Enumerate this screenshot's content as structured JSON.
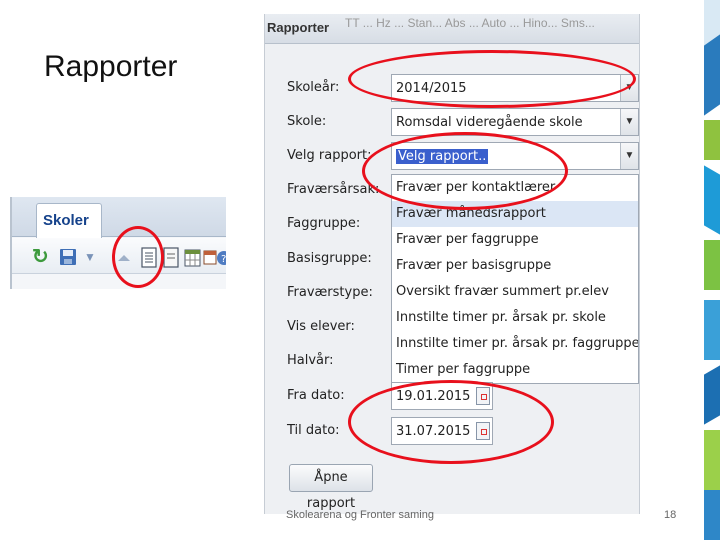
{
  "slide": {
    "title": "Rapporter",
    "footer": "Skolearena og Fronter saming",
    "page_number": "18"
  },
  "skoler_panel": {
    "tab_label": "Skoler",
    "toolbar_icons": [
      "refresh-icon",
      "save-icon",
      "dropdown-arrow-icon",
      "report-document-icon",
      "document-icon",
      "spreadsheet-export-icon",
      "grid-icon",
      "help-icon"
    ]
  },
  "dialog": {
    "title": "Rapporter",
    "background_tabs": "TT ...   Hz ...   Stan...   Abs ...   Auto ...   Hino...   Sms...",
    "fields": {
      "skolear": {
        "label": "Skoleår:",
        "value": "2014/2015"
      },
      "skole": {
        "label": "Skole:",
        "value": "Romsdal videregående skole"
      },
      "velg_rapport": {
        "label": "Velg rapport:",
        "value": "Velg rapport.."
      },
      "fravarsarsak": {
        "label": "Fraværsårsak:"
      },
      "faggruppe": {
        "label": "Faggruppe:"
      },
      "basisgruppe": {
        "label": "Basisgruppe:"
      },
      "fravaerstype": {
        "label": "Fraværstype:"
      },
      "vis_elever": {
        "label": "Vis elever:"
      },
      "halvar": {
        "label": "Halvår:"
      },
      "fra_dato": {
        "label": "Fra dato:",
        "value": "19.01.2015"
      },
      "til_dato": {
        "label": "Til dato:",
        "value": "31.07.2015"
      }
    },
    "report_options": [
      "Fravær per kontaktlærer",
      "Fravær månedsrapport",
      "Fravær per faggruppe",
      "Fravær per basisgruppe",
      "Oversikt fravær summert pr.elev",
      "Innstilte timer pr. årsak pr. skole",
      "Innstilte timer pr. årsak pr. faggruppe",
      "Timer per faggruppe"
    ],
    "highlighted_option": 1,
    "open_button": "Åpne rapport"
  },
  "colors": {
    "annotation": "#e8101c",
    "header_text": "#15428b",
    "selection": "#3a5fcd"
  }
}
